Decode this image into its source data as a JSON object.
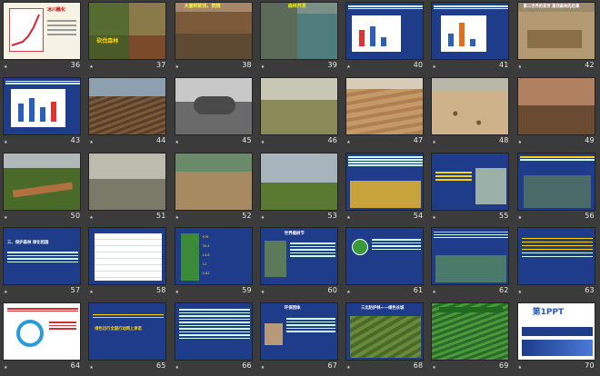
{
  "slides": [
    {
      "num": "36",
      "label": "冰川融化"
    },
    {
      "num": "37",
      "label": "砍伐森林"
    },
    {
      "num": "38",
      "label": "大面积砍伐、焚烧"
    },
    {
      "num": "39",
      "label": "森林开发"
    },
    {
      "num": "40",
      "label": ""
    },
    {
      "num": "41",
      "label": ""
    },
    {
      "num": "42",
      "label": "第三世界的贫穷 滥伐森林的后果"
    },
    {
      "num": "43",
      "label": ""
    },
    {
      "num": "44",
      "label": ""
    },
    {
      "num": "45",
      "label": ""
    },
    {
      "num": "46",
      "label": ""
    },
    {
      "num": "47",
      "label": ""
    },
    {
      "num": "48",
      "label": ""
    },
    {
      "num": "49",
      "label": ""
    },
    {
      "num": "50",
      "label": ""
    },
    {
      "num": "51",
      "label": ""
    },
    {
      "num": "52",
      "label": ""
    },
    {
      "num": "53",
      "label": ""
    },
    {
      "num": "54",
      "label": ""
    },
    {
      "num": "55",
      "label": ""
    },
    {
      "num": "56",
      "label": ""
    },
    {
      "num": "57",
      "label": "三、保护森林 绿化祖国"
    },
    {
      "num": "58",
      "label": ""
    },
    {
      "num": "59",
      "label": ""
    },
    {
      "num": "60",
      "label": "世界植树节"
    },
    {
      "num": "61",
      "label": ""
    },
    {
      "num": "62",
      "label": ""
    },
    {
      "num": "63",
      "label": ""
    },
    {
      "num": "64",
      "label": ""
    },
    {
      "num": "65",
      "label": "绿色出行全国行动网上承诺"
    },
    {
      "num": "66",
      "label": ""
    },
    {
      "num": "67",
      "label": "环保团体"
    },
    {
      "num": "68",
      "label": "三北防护林——绿色长城"
    },
    {
      "num": "69",
      "label": ""
    },
    {
      "num": "70",
      "label": "第1PPT"
    }
  ],
  "chart59": [
    "976",
    "30.4",
    "14.8",
    "12",
    "0.82"
  ],
  "ppt_brand": "第1PPT"
}
